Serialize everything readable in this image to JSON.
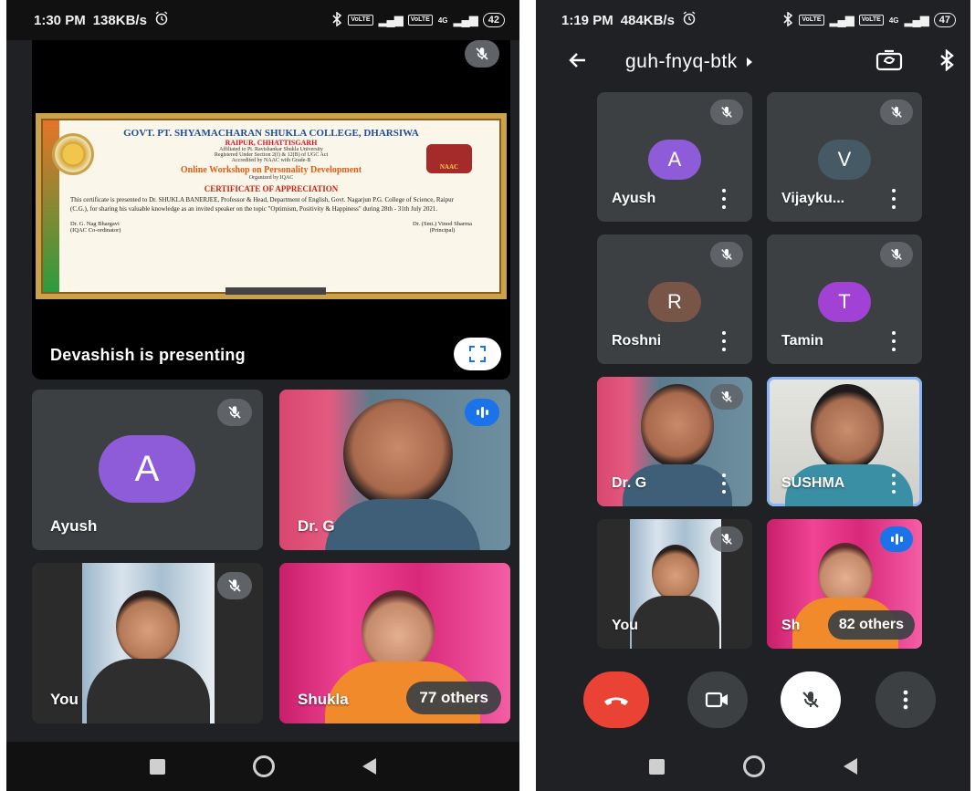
{
  "left": {
    "status": {
      "time": "1:30 PM",
      "speed": "138KB/s",
      "battery": "42",
      "lte": "VoLTE",
      "net": "4G"
    },
    "presentation": {
      "presenting_label": "Devashish is presenting",
      "certificate": {
        "college": "GOVT. PT. SHYAMACHARAN SHUKLA COLLEGE, DHARSIWA",
        "place": "RAIPUR, CHHATTISGARH",
        "affiliation": "Affiliated to Pt. Ravishankar Shukla University",
        "registration": "Registered Under Section 2(f) & 12(B) of UGC Act",
        "accreditation": "Accredited by NAAC with Grade-B",
        "workshop": "Online Workshop on Personality Development",
        "organized": "Organized by IQAC",
        "heading": "CERTIFICATE OF APPRECIATION",
        "body": "This certificate is presented to Dr. SHUKLA BANERJEE, Professor & Head, Department of English, Govt. Nagarjun P.G. College of Science, Raipur (C.G.), for sharing his valuable knowledge as an invited speaker on the topic \"Optimism, Positivity & Happiness\" during 28th - 31th July 2021.",
        "sig_left_name": "Dr. G. Nag Bhargavi",
        "sig_left_role": "(IQAC Co-ordinator)",
        "sig_right_name": "Dr. (Smt.) Vinod Sharma",
        "sig_right_role": "(Principal)",
        "badge": "NAAC",
        "badge_grade": "B"
      }
    },
    "tiles": {
      "ayush": {
        "name": "Ayush",
        "initial": "A"
      },
      "drg": {
        "name": "Dr. G"
      },
      "you": {
        "name": "You"
      },
      "shukla": {
        "name": "Shukla",
        "others": "77 others"
      }
    }
  },
  "right": {
    "status": {
      "time": "1:19 PM",
      "speed": "484KB/s",
      "battery": "47",
      "lte": "VoLTE",
      "net": "4G"
    },
    "meeting_code": "guh-fnyq-btk",
    "tiles": {
      "ayush": {
        "name": "Ayush",
        "initial": "A"
      },
      "vijay": {
        "name": "Vijayku...",
        "initial": "V"
      },
      "roshni": {
        "name": "Roshni",
        "initial": "R"
      },
      "tamin": {
        "name": "Tamin",
        "initial": "T"
      },
      "drg": {
        "name": "Dr. G"
      },
      "sushma": {
        "name": "SUSHMA"
      },
      "you": {
        "name": "You"
      },
      "shukla": {
        "name": "Sh",
        "others": "82 others"
      }
    }
  },
  "colors": {
    "background": "#202124",
    "tile": "#3c4043",
    "avatar_purple": "#8e5cd9",
    "avatar_slate": "#455a64",
    "avatar_brown": "#795548",
    "avatar_violet": "#a142d4",
    "hangup": "#ea4335",
    "speaking": "#1a73e8",
    "selected_border": "#8ab4f8"
  },
  "icons": [
    "mic-off-icon",
    "audio-level-icon",
    "fullscreen-icon",
    "back-arrow-icon",
    "camera-flip-icon",
    "bluetooth-icon",
    "more-vert-icon",
    "hangup-icon",
    "video-icon",
    "alarm-icon",
    "nav-home-icon",
    "nav-back-icon",
    "nav-recents-icon"
  ]
}
